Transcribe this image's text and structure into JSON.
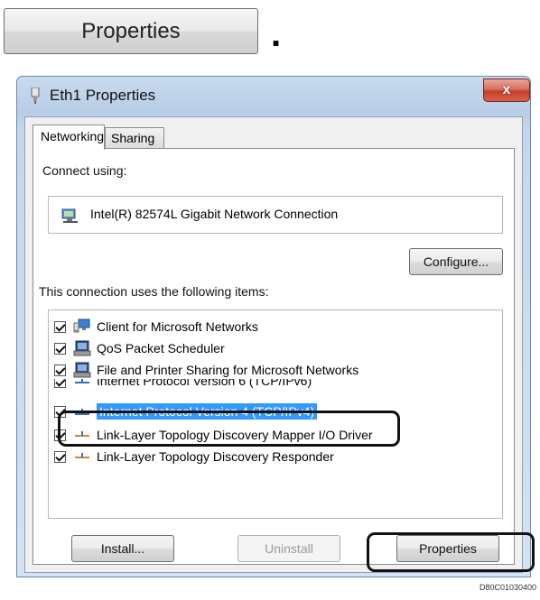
{
  "top_button": {
    "label": "Properties",
    "period": "."
  },
  "window": {
    "title": "Eth1 Properties",
    "close_label": "x",
    "tabs": [
      {
        "label": "Networking"
      },
      {
        "label": "Sharing"
      }
    ],
    "connect_using_label": "Connect using:",
    "adapter_name": "Intel(R) 82574L Gigabit Network Connection",
    "configure_label": "Configure...",
    "items_label": "This connection uses the following items:",
    "items": [
      {
        "label": "Client for Microsoft Networks",
        "checked": true,
        "icon": "network-client-icon"
      },
      {
        "label": "QoS Packet Scheduler",
        "checked": true,
        "icon": "service-icon"
      },
      {
        "label": "File and Printer Sharing for Microsoft Networks",
        "checked": true,
        "icon": "service-icon"
      },
      {
        "label": "Internet Protocol Version 6 (TCP/IPv6)",
        "checked": true,
        "icon": "protocol-icon"
      },
      {
        "label": "Internet Protocol Version 4 (TCP/IPv4)",
        "checked": true,
        "icon": "protocol-icon",
        "selected": true
      },
      {
        "label": "Link-Layer Topology Discovery Mapper I/O Driver",
        "checked": true,
        "icon": "protocol-icon"
      },
      {
        "label": "Link-Layer Topology Discovery Responder",
        "checked": true,
        "icon": "protocol-icon"
      }
    ],
    "install_label": "Install...",
    "uninstall_label": "Uninstall",
    "properties_label": "Properties"
  },
  "figure_code": "D80C01030400",
  "colors": {
    "selection": "#3399ff",
    "titlebar": "#c8daef",
    "close": "#c2402a"
  }
}
